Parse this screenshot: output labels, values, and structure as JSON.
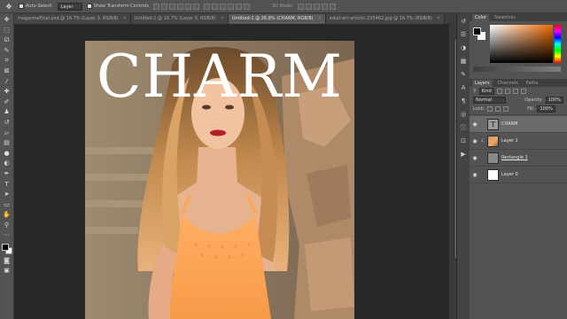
{
  "options_bar": {
    "auto_select_label": "Auto-Select:",
    "auto_select_target": "Layer",
    "transform_controls_label": "Show Transform Controls",
    "mode_3d_label": "3D Mode:"
  },
  "document_tabs": [
    {
      "label": "magazineFinal.psd @ 16.7% (Layer 3, RGB/8)",
      "active": false
    },
    {
      "label": "Untitled-1 @ 16.7% (Layer 5, RGB/8)",
      "active": false
    },
    {
      "label": "Untitled-1 @ 26.8% (CHARM, RGB/8)",
      "active": true
    },
    {
      "label": "adult-art-artistic-235462.jpg @ 16.7% (RGB/8)",
      "active": false
    }
  ],
  "canvas": {
    "headline": "CHARM"
  },
  "color_panel": {
    "tabs": [
      "Color",
      "Swatches"
    ],
    "fg_color": "#000000",
    "bg_color": "#ffffff",
    "hue_color": "#f06a00"
  },
  "layers_panel": {
    "tabs": [
      "Layers",
      "Channels",
      "Paths"
    ],
    "filter_kind": "Kind",
    "blend_mode": "Normal",
    "opacity_label": "Opacity:",
    "opacity_value": "100%",
    "lock_label": "Lock:",
    "fill_label": "Fill:",
    "fill_value": "100%",
    "layers": [
      {
        "name": "CHARM",
        "kind": "type",
        "visible": true,
        "selected": true
      },
      {
        "name": "Layer 1",
        "kind": "photo",
        "visible": true,
        "selected": false
      },
      {
        "name": "Rectangle 1",
        "kind": "shape",
        "visible": true,
        "selected": false
      },
      {
        "name": "Layer 0",
        "kind": "white",
        "visible": true,
        "selected": false
      }
    ]
  },
  "icons": {
    "tools": [
      "move-icon",
      "artboard-icon",
      "marquee-icon",
      "lasso-icon",
      "quick-select-icon",
      "crop-icon",
      "eyedropper-icon",
      "healing-icon",
      "brush-icon",
      "clone-stamp-icon",
      "history-brush-icon",
      "eraser-icon",
      "gradient-icon",
      "blur-icon",
      "dodge-icon",
      "pen-icon",
      "type-icon",
      "path-select-icon",
      "rectangle-icon",
      "hand-icon",
      "zoom-icon"
    ]
  },
  "colors": {
    "accent_photo": "#f3a660"
  }
}
